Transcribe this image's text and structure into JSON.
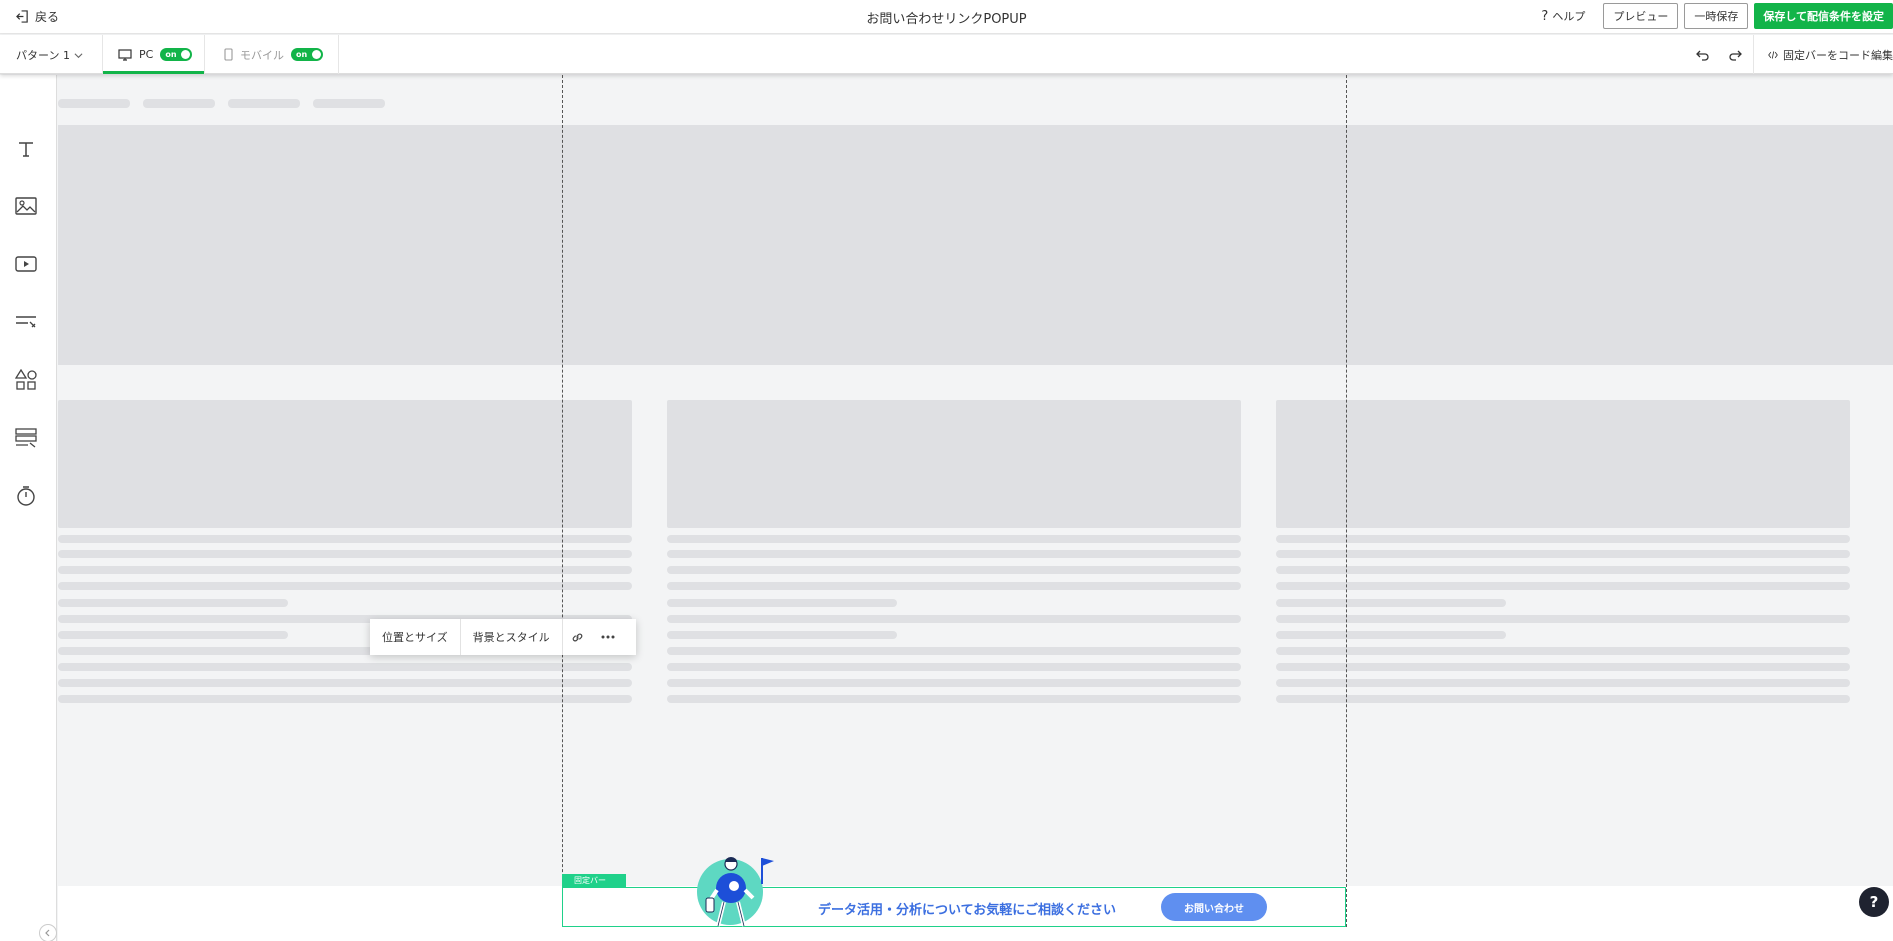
{
  "header": {
    "back_label": "戻る",
    "title": "お問い合わせリンクPOPUP",
    "help_label": "ヘルプ",
    "preview_label": "プレビュー",
    "draft_label": "一時保存",
    "save_label": "保存して配信条件を設定"
  },
  "subbar": {
    "pattern_label": "パターン 1",
    "pc_label": "PC",
    "pc_toggle": "on",
    "mobile_label": "モバイル",
    "mobile_toggle": "on",
    "code_edit_label": "固定バーをコード編集"
  },
  "left_tools": [
    "text-tool",
    "image-tool",
    "video-tool",
    "input-tool",
    "shapes-tool",
    "form-tool",
    "timer-tool"
  ],
  "context_toolbar": {
    "position_size": "位置とサイズ",
    "background_style": "背景とスタイル"
  },
  "fixed_bar": {
    "tag_label": "固定バー",
    "text": "データ活用・分析についてお気軽にご相談ください",
    "button_label": "お問い合わせ"
  },
  "help_fab": "?",
  "colors": {
    "accent_green": "#12b449",
    "fixed_bar_green": "#1fd18a",
    "fixed_bar_text_blue": "#3c6fe0",
    "cta_blue": "#5f8ff0",
    "placeholder_gray": "#dfe0e3"
  }
}
